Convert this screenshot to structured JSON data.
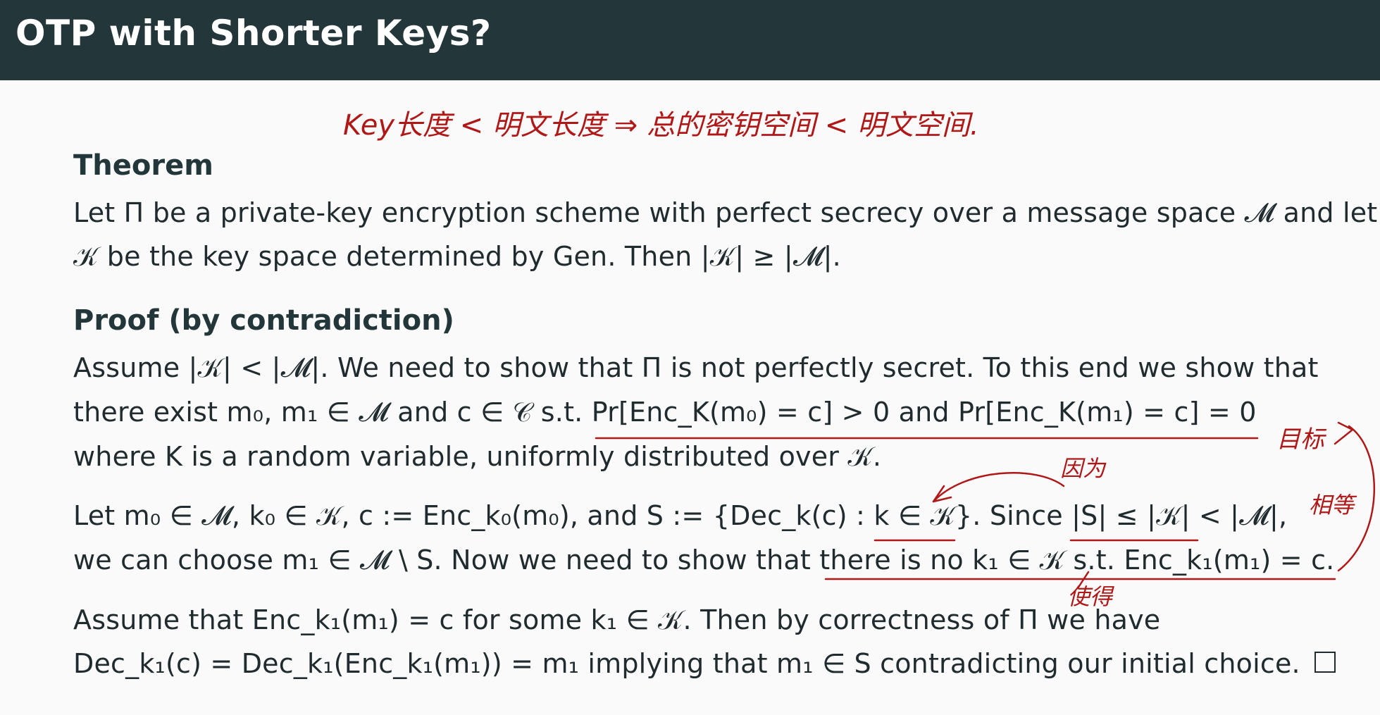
{
  "slide": {
    "title": "OTP with Shorter Keys?"
  },
  "theorem": {
    "heading": "Theorem",
    "line1": "Let Π be a private-key encryption scheme with perfect secrecy over a message space 𝓜 and let",
    "line2": "𝒦 be the key space determined by Gen. Then |𝒦| ≥ |𝓜|."
  },
  "proof": {
    "heading": "Proof (by contradiction)",
    "p1_line1": "Assume |𝒦| < |𝓜|. We need to show that Π is not perfectly secret. To this end we show that",
    "p1_line2": "there exist m₀, m₁ ∈ 𝓜 and c ∈ 𝒞 s.t. Pr[Enc_K(m₀) = c] > 0 and Pr[Enc_K(m₁) = c] = 0",
    "p1_line3": "where K is a random variable, uniformly distributed over 𝒦.",
    "p2_line1": "Let m₀ ∈ 𝓜, k₀ ∈ 𝒦, c := Enc_k₀(m₀), and S := {Dec_k(c) : k ∈ 𝒦}. Since |S| ≤ |𝒦| < |𝓜|,",
    "p2_line2": "we can choose m₁ ∈ 𝓜 \\ S. Now we need to show that there is no k₁ ∈ 𝒦 s.t. Enc_k₁(m₁) = c.",
    "p3_line1": "Assume that Enc_k₁(m₁) = c for some k₁ ∈ 𝒦. Then by correctness of Π we have",
    "p3_line2": "Dec_k₁(c) = Dec_k₁(Enc_k₁(m₁)) = m₁ implying that m₁ ∈ S contradicting our initial choice."
  },
  "annotations": {
    "top_note": "Key长度 < 明文长度 ⇒ 总的密钥空间 < 明文空间.",
    "goal": "目标",
    "because": "因为",
    "equal": "相等",
    "such_that": "使得"
  },
  "colors": {
    "titlebar": "#23373b",
    "background": "#fafafa",
    "ink": "#b01818"
  }
}
